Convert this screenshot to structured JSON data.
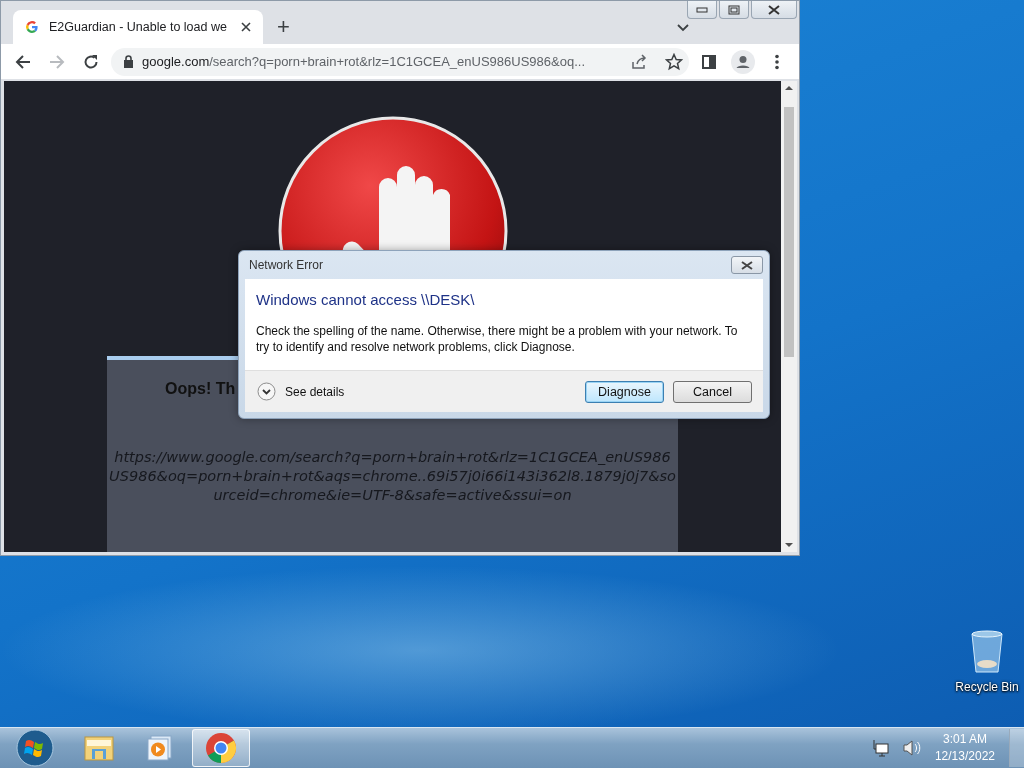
{
  "browser": {
    "tabs": [
      {
        "title": "E2Guardian - Unable to load we",
        "selected": true
      }
    ],
    "new_tab": "+",
    "address": {
      "host": "google.com",
      "path": "/search?q=porn+brain+rot&rlz=1C1GCEA_enUS986US986&oq..."
    },
    "page": {
      "heading": "Oops! Th",
      "url": "https://www.google.com/search?q=porn+brain+rot&rlz=1C1GCEA_enUS986US986&oq=porn+brain+rot&aqs=chrome..69i57j0i66i143i362l8.1879j0j7&sourceid=chrome&ie=UTF-8&safe=active&ssui=on"
    }
  },
  "dialog": {
    "title": "Network Error",
    "heading": "Windows cannot access \\\\DESK\\",
    "message": "Check the spelling of the name. Otherwise, there might be a problem with your network. To try to identify and resolve network problems, click Diagnose.",
    "details": "See details",
    "buttons": [
      {
        "label": "Diagnose",
        "default": true
      },
      {
        "label": "Cancel",
        "default": false
      }
    ]
  },
  "desktop": {
    "icons": [
      {
        "label": "Recycle Bin"
      }
    ]
  },
  "taskbar": {
    "apps": [
      {
        "kind": "explorer",
        "selected": false
      },
      {
        "kind": "media",
        "selected": false
      },
      {
        "kind": "chrome",
        "selected": true
      }
    ],
    "time": "3:01 AM",
    "date": "12/13/2022"
  }
}
